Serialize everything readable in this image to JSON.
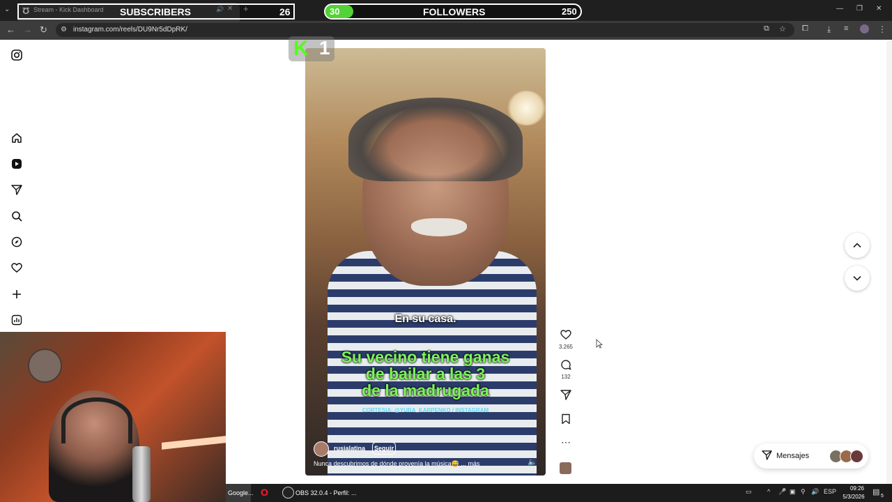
{
  "browser": {
    "tab_title": "Stream - Kick Dashboard",
    "tab_favicon": "Ʊ",
    "url": "instagram.com/reels/DU9Nr5dDpRK/",
    "window_controls": [
      "—",
      "❐",
      "✕"
    ]
  },
  "overlay": {
    "subscribers_label": "SUBSCRIBERS",
    "subscribers_count": "26",
    "followers_label": "FOLLOWERS",
    "followers_progress": "30",
    "followers_goal": "250",
    "kick_badge_letter": "K",
    "kick_badge_number": "1",
    "colors": {
      "kick_green": "#53fc18",
      "progress_green": "#53d335"
    }
  },
  "sidebar": {
    "icons": [
      "instagram-logo-icon",
      "home-icon",
      "reels-icon",
      "messages-icon",
      "search-icon",
      "explore-icon",
      "notifications-icon",
      "create-icon",
      "dashboard-icon"
    ]
  },
  "reel": {
    "caption_small": "En su casa.",
    "caption_big_1": "Su vecino tiene ganas",
    "caption_big_2": "de bailar a las 3",
    "caption_big_3": "de la madrugada",
    "credit": "CORTESIA: @YURA_KARPENKO / INSTAGRAM",
    "author": "rusialatina",
    "follow_label": "Seguir",
    "post_caption": "Nunca descubrimos de dónde provenía la música😅 ... más"
  },
  "actions": {
    "likes": "3.265",
    "comments": "132"
  },
  "messages": {
    "label": "Mensajes"
  },
  "taskbar": {
    "google_label": "Google...",
    "obs_label": "OBS 32.0.4 - Perfil: ...",
    "language": "ESP",
    "time": "09:26",
    "date": "5/3/2026",
    "notification_count": "5"
  }
}
